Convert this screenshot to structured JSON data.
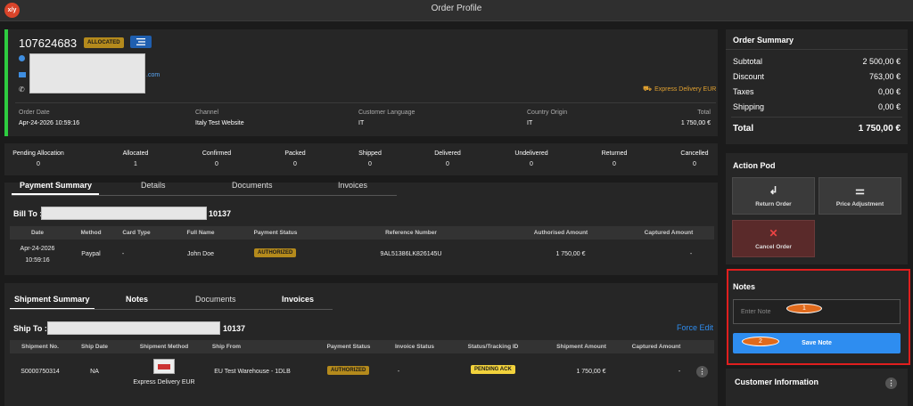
{
  "app": {
    "title": "Order Profile",
    "logo_text": "x/y"
  },
  "order": {
    "id": "107624683",
    "status": "ALLOCATED",
    "email_suffix": ".com",
    "delivery": "Express Delivery EUR",
    "info": [
      {
        "label": "Order Date",
        "value": "Apr-24-2026 10:59:16"
      },
      {
        "label": "Channel",
        "value": "Italy Test Website"
      },
      {
        "label": "Customer Language",
        "value": "IT"
      },
      {
        "label": "Country Origin",
        "value": "IT"
      },
      {
        "label": "Total",
        "value": "1 750,00 €"
      }
    ]
  },
  "status_counts": [
    {
      "label": "Pending Allocation",
      "value": "0"
    },
    {
      "label": "Allocated",
      "value": "1"
    },
    {
      "label": "Confirmed",
      "value": "0"
    },
    {
      "label": "Packed",
      "value": "0"
    },
    {
      "label": "Shipped",
      "value": "0"
    },
    {
      "label": "Delivered",
      "value": "0"
    },
    {
      "label": "Undelivered",
      "value": "0"
    },
    {
      "label": "Returned",
      "value": "0"
    },
    {
      "label": "Cancelled",
      "value": "0"
    }
  ],
  "payment": {
    "tabs": [
      "Payment Summary",
      "Details",
      "Documents",
      "Invoices"
    ],
    "bill_to_label": "Bill To :",
    "bill_to_suffix": "10137",
    "headers": [
      "Date",
      "Method",
      "Card Type",
      "Full Name",
      "Payment Status",
      "Reference Number",
      "Authorised Amount",
      "Captured Amount"
    ],
    "row": {
      "date": "Apr-24-2026",
      "time": "10:59:16",
      "method": "Paypal",
      "card_type": "-",
      "full_name": "John Doe",
      "status": "AUTHORIZED",
      "reference": "9AL51386LK826145U",
      "authorised": "1 750,00 €",
      "captured": "-"
    }
  },
  "shipment": {
    "tabs": [
      "Shipment Summary",
      "Notes",
      "Documents",
      "Invoices"
    ],
    "ship_to_label": "Ship To :",
    "ship_to_suffix": "10137",
    "force_edit": "Force Edit",
    "headers": [
      "Shipment No.",
      "Ship Date",
      "Shipment Method",
      "Ship From",
      "Payment Status",
      "Invoice Status",
      "Status/Tracking ID",
      "Shipment Amount",
      "Captured Amount"
    ],
    "row": {
      "number": "S0000750314",
      "date": "NA",
      "method": "Express Delivery EUR",
      "from": "EU Test Warehouse - 1DLB",
      "payment_status": "AUTHORIZED",
      "invoice_status": "-",
      "tracking": "PENDING ACK",
      "amount": "1 750,00 €",
      "captured": "-"
    }
  },
  "summary": {
    "title": "Order Summary",
    "rows": [
      {
        "label": "Subtotal",
        "value": "2 500,00 €"
      },
      {
        "label": "Discount",
        "value": "763,00 €"
      },
      {
        "label": "Taxes",
        "value": "0,00 €"
      },
      {
        "label": "Shipping",
        "value": "0,00 €"
      }
    ],
    "total_label": "Total",
    "total_value": "1 750,00 €"
  },
  "action_pod": {
    "title": "Action Pod",
    "return": "Return Order",
    "price": "Price Adjustment",
    "cancel": "Cancel Order"
  },
  "notes": {
    "title": "Notes",
    "placeholder": "Enter Note",
    "save": "Save Note",
    "marker1": "1",
    "marker2": "2"
  },
  "customer": {
    "title": "Customer Information"
  },
  "colors": {
    "accent": "#2e8df0",
    "allocated": "#b48a1c",
    "highlight": "#e01e1e",
    "marker": "#e06a1c"
  }
}
